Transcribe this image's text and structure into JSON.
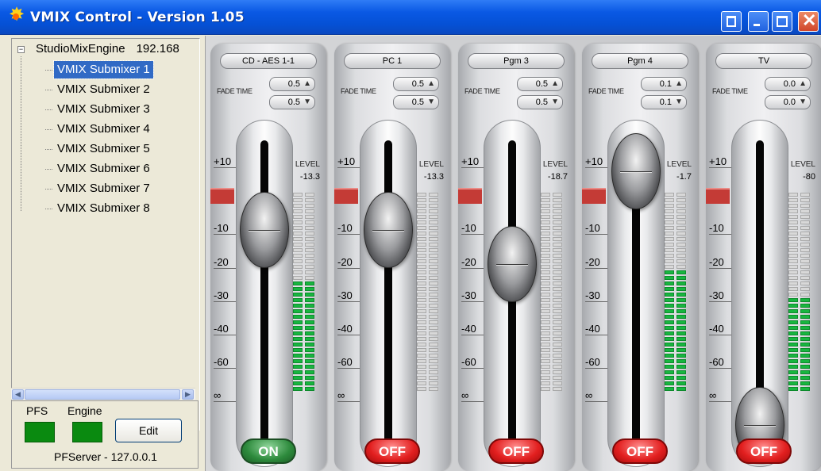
{
  "window": {
    "title": "VMIX Control - Version 1.05"
  },
  "tree": {
    "root_label": "StudioMixEngine",
    "root_ip": "192.168",
    "items": [
      {
        "label": "VMIX Submixer 1",
        "selected": true
      },
      {
        "label": "VMIX Submixer 2",
        "selected": false
      },
      {
        "label": "VMIX Submixer 3",
        "selected": false
      },
      {
        "label": "VMIX Submixer 4",
        "selected": false
      },
      {
        "label": "VMIX Submixer 5",
        "selected": false
      },
      {
        "label": "VMIX Submixer 6",
        "selected": false
      },
      {
        "label": "VMIX Submixer 7",
        "selected": false
      },
      {
        "label": "VMIX Submixer 8",
        "selected": false
      }
    ]
  },
  "status": {
    "pfs_label": "PFS",
    "engine_label": "Engine",
    "edit_label": "Edit",
    "server": "PFServer - 127.0.0.1",
    "indicator_color": "#0a8a10"
  },
  "mixer": {
    "fade_time_label": "FADE TIME",
    "level_label": "LEVEL",
    "scale": [
      "+10",
      "-10",
      "-20",
      "-30",
      "-40",
      "-60",
      "∞"
    ],
    "channels": [
      {
        "name": "CD - AES 1-1",
        "fade_up": "0.5",
        "fade_down": "0.5",
        "level": "-13.3",
        "fader": 0.71,
        "meter": 0.55,
        "state": "ON"
      },
      {
        "name": "PC 1",
        "fade_up": "0.5",
        "fade_down": "0.5",
        "level": "-13.3",
        "fader": 0.71,
        "meter": 0.0,
        "state": "OFF"
      },
      {
        "name": "Pgm 3",
        "fade_up": "0.5",
        "fade_down": "0.5",
        "level": "-18.7",
        "fader": 0.6,
        "meter": 0.0,
        "state": "OFF"
      },
      {
        "name": "Pgm 4",
        "fade_up": "0.1",
        "fade_down": "0.1",
        "level": "-1.7",
        "fader": 0.9,
        "meter": 0.62,
        "state": "OFF"
      },
      {
        "name": "TV",
        "fade_up": "0.0",
        "fade_down": "0.0",
        "level": "-80",
        "fader": 0.08,
        "meter": 0.48,
        "state": "OFF"
      }
    ]
  }
}
